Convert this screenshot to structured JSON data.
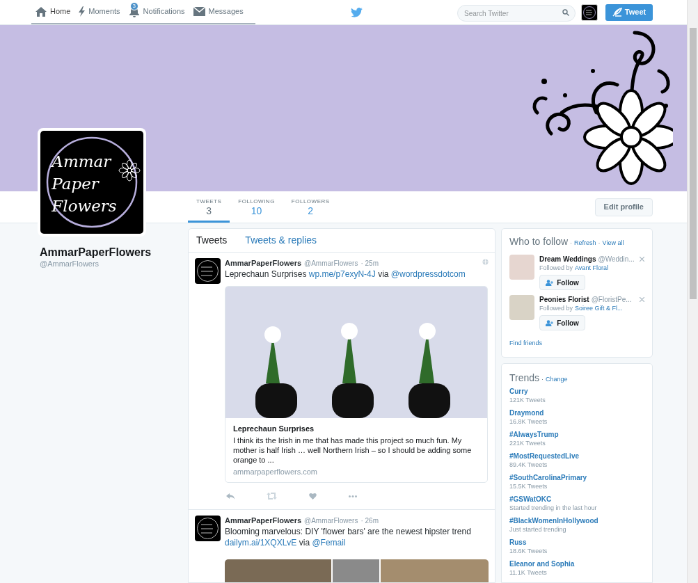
{
  "nav": {
    "items": [
      {
        "label": "Home",
        "selected": true
      },
      {
        "label": "Moments",
        "selected": false
      },
      {
        "label": "Notifications",
        "badge": "3",
        "selected": false
      },
      {
        "label": "Messages",
        "selected": false
      }
    ],
    "search": {
      "placeholder": "Search Twitter"
    },
    "tweet_button": "Tweet"
  },
  "profile": {
    "name": "AmmarPaperFlowers",
    "handle": "@AmmarFlowers",
    "logo_lines": [
      "Ammar",
      "Paper",
      "Flowers"
    ]
  },
  "stats": [
    {
      "label": "TWEETS",
      "value": "3",
      "selected": true
    },
    {
      "label": "FOLLOWING",
      "value": "10",
      "selected": false
    },
    {
      "label": "FOLLOWERS",
      "value": "2",
      "selected": false
    }
  ],
  "edit_profile": "Edit profile",
  "timeline_tabs": [
    {
      "label": "Tweets",
      "selected": true
    },
    {
      "label": "Tweets & replies",
      "selected": false
    }
  ],
  "tweets": [
    {
      "name": "AmmarPaperFlowers",
      "handle": "@AmmarFlowers",
      "time": "· 25m",
      "globe": true,
      "text": [
        {
          "text": "Leprechaun Surprises ",
          "link": false
        },
        {
          "text": "wp.me/p7exyN-4J",
          "link": true
        },
        {
          "text": " via ",
          "link": false
        },
        {
          "text": "@wordpressdotcom",
          "link": true
        }
      ],
      "card": {
        "title": "Leprechaun Surprises",
        "description": "I think its the Irish in me that has made this project so much fun. My mother is half Irish … well Northern Irish – so I should be adding some orange to ...",
        "domain": "ammarpaperflowers.com"
      }
    },
    {
      "name": "AmmarPaperFlowers",
      "handle": "@AmmarFlowers",
      "time": "· 26m",
      "globe": false,
      "text": [
        {
          "text": "Blooming marvelous: DIY 'flower bars' are the newest hipster trend ",
          "link": false
        },
        {
          "text": "dailym.ai/1XQXLvE",
          "link": true
        },
        {
          "text": " via ",
          "link": false
        },
        {
          "text": "@Femail",
          "link": true
        }
      ]
    }
  ],
  "who_to_follow": {
    "title": "Who to follow",
    "separators": [
      "·",
      "·"
    ],
    "refresh": "Refresh",
    "view_all": "View all",
    "suggestions": [
      {
        "name": "Dream Weddings",
        "handle": "@Weddin...",
        "followed_by_label": "Followed by",
        "followed_by": "Avant Floral",
        "button": "Follow"
      },
      {
        "name": "Peonies Florist",
        "handle": "@FloristPe...",
        "followed_by_label": "Followed by",
        "followed_by": "Soiree Gift & Fl...",
        "button": "Follow"
      }
    ],
    "find_friends": "Find friends"
  },
  "trends": {
    "title": "Trends",
    "separator": "·",
    "change": "Change",
    "items": [
      {
        "name": "Curry",
        "meta": "121K Tweets"
      },
      {
        "name": "Draymond",
        "meta": "16.8K Tweets"
      },
      {
        "name": "#AlwaysTrump",
        "meta": "221K Tweets"
      },
      {
        "name": "#MostRequestedLive",
        "meta": "89.4K Tweets"
      },
      {
        "name": "#SouthCarolinaPrimary",
        "meta": "15.5K Tweets"
      },
      {
        "name": "#GSWatOKC",
        "meta": "Started trending in the last hour"
      },
      {
        "name": "#BlackWomenInHollywood",
        "meta": "Just started trending"
      },
      {
        "name": "Russ",
        "meta": "18.6K Tweets"
      },
      {
        "name": "Eleanor and Sophia",
        "meta": "11.1K Tweets"
      }
    ]
  }
}
